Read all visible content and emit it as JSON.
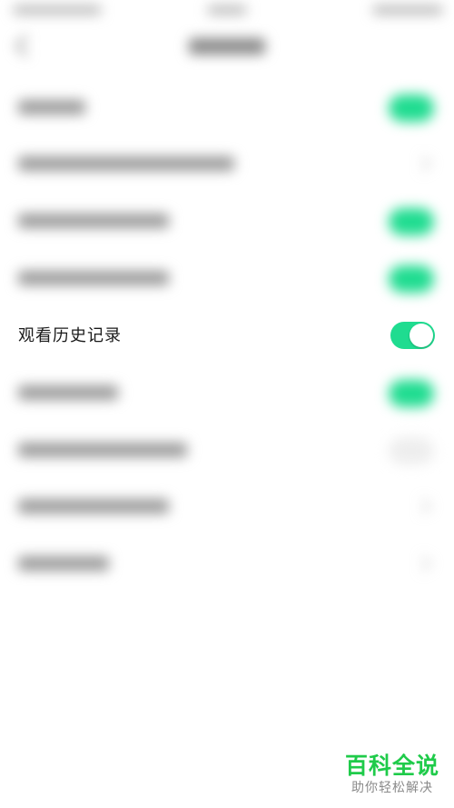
{
  "settings": {
    "history_item": {
      "label": "观看历史记录",
      "toggle_on": true
    }
  },
  "colors": {
    "toggle_on": "#1fdc90",
    "watermark_green": "#1fcb4a"
  },
  "watermark": {
    "main": "百科全说",
    "sub": "助你轻松解决"
  }
}
